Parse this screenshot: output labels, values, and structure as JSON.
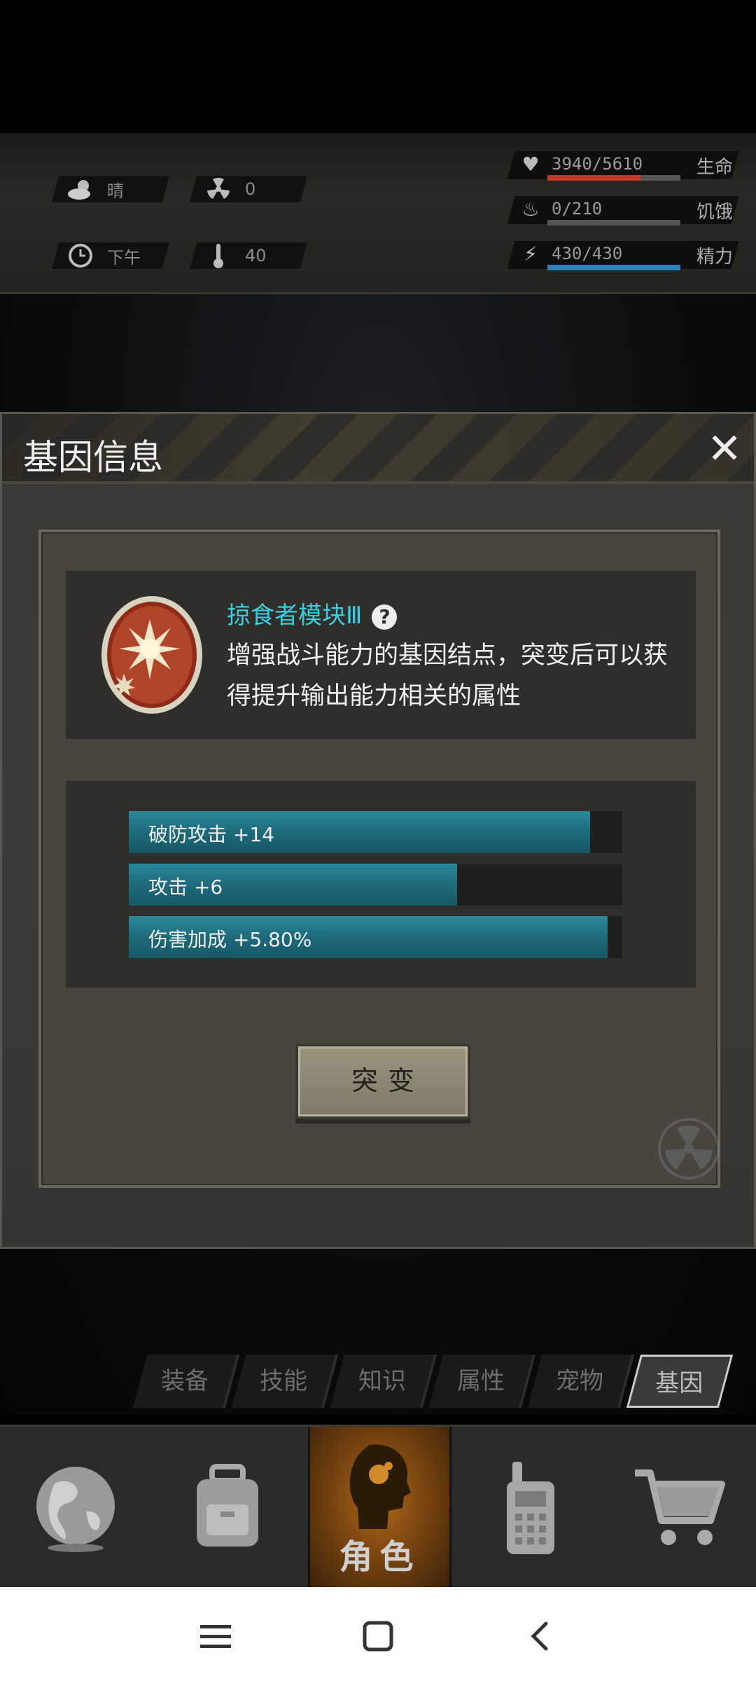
{
  "status": {
    "weather": {
      "icon": "cloud-sun-icon",
      "text": "晴"
    },
    "radiation": {
      "icon": "radiation-icon",
      "text": "0"
    },
    "time": {
      "icon": "clock-icon",
      "text": "下午"
    },
    "temperature": {
      "icon": "thermometer-icon",
      "text": "40"
    },
    "vitals": [
      {
        "icon": "heart-icon",
        "value": "3940/5610",
        "label": "生命",
        "ratio": 0.7,
        "color": "#c0392b"
      },
      {
        "icon": "stomach-icon",
        "value": "0/210",
        "label": "饥饿",
        "ratio": 0.0,
        "color": "#8a8a8a"
      },
      {
        "icon": "energy-icon",
        "value": "430/430",
        "label": "精力",
        "ratio": 1.0,
        "color": "#2f7fb8"
      }
    ]
  },
  "dialog": {
    "title": "基因信息",
    "close_icon": "close-icon",
    "gene": {
      "icon": "predator-gene-icon",
      "name": "掠食者模块Ⅲ",
      "description": "增强战斗能力的基因结点，突变后可以获得提升输出能力相关的属性"
    },
    "stats": [
      {
        "label": "破防攻击 +14",
        "ratio": 0.935
      },
      {
        "label": "攻击 +6",
        "ratio": 0.665
      },
      {
        "label": "伤害加成 +5.80%",
        "ratio": 0.97
      }
    ],
    "mutate_label": "突变"
  },
  "tabs": [
    {
      "label": "装备",
      "active": false
    },
    {
      "label": "技能",
      "active": false
    },
    {
      "label": "知识",
      "active": false
    },
    {
      "label": "属性",
      "active": false
    },
    {
      "label": "宠物",
      "active": false
    },
    {
      "label": "基因",
      "active": true
    }
  ],
  "bottom_nav": [
    {
      "icon": "globe-icon",
      "label": ""
    },
    {
      "icon": "backpack-icon",
      "label": ""
    },
    {
      "icon": "character-head-icon",
      "label": "角色",
      "active": true
    },
    {
      "icon": "walkie-talkie-icon",
      "label": ""
    },
    {
      "icon": "cart-icon",
      "label": ""
    }
  ]
}
